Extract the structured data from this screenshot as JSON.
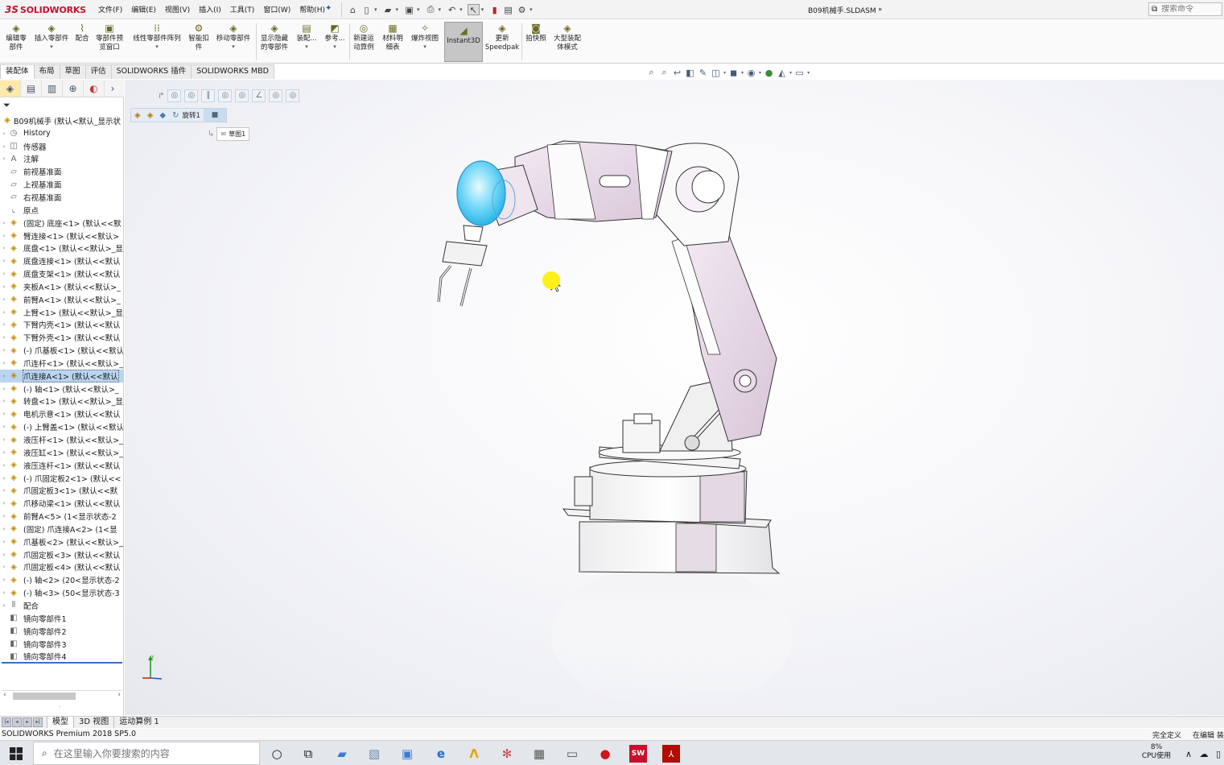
{
  "app": {
    "logo_ds": "3S",
    "logo_text": "SOLIDWORKS",
    "document_title": "B09机械手.SLDASM *"
  },
  "menu": [
    "文件(F)",
    "编辑(E)",
    "视图(V)",
    "插入(I)",
    "工具(T)",
    "窗口(W)",
    "帮助(H)"
  ],
  "search": {
    "placeholder": "搜索命令"
  },
  "commands": [
    {
      "label": "编辑零\n部件"
    },
    {
      "label": "插入零部件"
    },
    {
      "label": "配合"
    },
    {
      "label": "零部件预\n览窗口"
    },
    {
      "label": "线性零部件阵列"
    },
    {
      "label": "智能扣\n件"
    },
    {
      "label": "移动零部件"
    },
    {
      "label": "显示隐藏\n的零部件"
    },
    {
      "label": "装配..."
    },
    {
      "label": "参考..."
    },
    {
      "label": "新建运\n动算例"
    },
    {
      "label": "材料明\n细表"
    },
    {
      "label": "爆炸视图"
    },
    {
      "label": "Instant3D"
    },
    {
      "label": "更新\nSpeedpak"
    },
    {
      "label": "拍快照"
    },
    {
      "label": "大型装配\n体模式"
    }
  ],
  "tabs": [
    "装配体",
    "布局",
    "草图",
    "评估",
    "SOLIDWORKS 插件",
    "SOLIDWORKS MBD"
  ],
  "tree": {
    "root": "B09机械手 (默认<默认_显示状",
    "items": [
      {
        "label": "History",
        "icon": "history-icon"
      },
      {
        "label": "传感器",
        "icon": "sensor-icon"
      },
      {
        "label": "注解",
        "icon": "annotation-icon"
      },
      {
        "label": "前视基准面",
        "icon": "plane-icon"
      },
      {
        "label": "上视基准面",
        "icon": "plane-icon"
      },
      {
        "label": "右视基准面",
        "icon": "plane-icon"
      },
      {
        "label": "原点",
        "icon": "origin-icon"
      },
      {
        "label": "(固定) 底座<1> (默认<<默",
        "icon": "part-icon"
      },
      {
        "label": "臂连接<1> (默认<<默认>",
        "icon": "part-icon"
      },
      {
        "label": "底盘<1> (默认<<默认>_显",
        "icon": "part-icon"
      },
      {
        "label": "底盘连接<1> (默认<<默认",
        "icon": "part-icon"
      },
      {
        "label": "底盘支架<1> (默认<<默认",
        "icon": "part-icon"
      },
      {
        "label": "夹板A<1> (默认<<默认>_",
        "icon": "part-icon"
      },
      {
        "label": "前臂A<1> (默认<<默认>_",
        "icon": "part-icon"
      },
      {
        "label": "上臂<1> (默认<<默认>_显",
        "icon": "part-icon"
      },
      {
        "label": "下臂内壳<1> (默认<<默认",
        "icon": "part-icon"
      },
      {
        "label": "下臂外壳<1> (默认<<默认",
        "icon": "part-icon"
      },
      {
        "label": "(-) 爪基板<1> (默认<<默认",
        "icon": "part-icon"
      },
      {
        "label": "爪连杆<1> (默认<<默认>_",
        "icon": "part-icon"
      },
      {
        "label": "爪连接A<1> (默认<<默认",
        "icon": "part-icon",
        "selected": true
      },
      {
        "label": "(-) 轴<1> (默认<<默认>_",
        "icon": "part-icon"
      },
      {
        "label": "转盘<1> (默认<<默认>_显",
        "icon": "part-icon"
      },
      {
        "label": "电机示意<1> (默认<<默认",
        "icon": "part-icon"
      },
      {
        "label": "(-) 上臂盖<1> (默认<<默认",
        "icon": "part-icon"
      },
      {
        "label": "液压杆<1> (默认<<默认>_",
        "icon": "part-icon"
      },
      {
        "label": "液压缸<1> (默认<<默认>_",
        "icon": "part-icon"
      },
      {
        "label": "液压连杆<1> (默认<<默认",
        "icon": "part-icon"
      },
      {
        "label": "(-) 爪固定板2<1> (默认<<",
        "icon": "part-icon"
      },
      {
        "label": "爪固定板3<1> (默认<<默",
        "icon": "part-icon"
      },
      {
        "label": "爪移动梁<1> (默认<<默认",
        "icon": "part-icon"
      },
      {
        "label": "前臂A<5> (1<显示状态-2",
        "icon": "part-icon"
      },
      {
        "label": "(固定) 爪连接A<2> (1<显",
        "icon": "part-icon"
      },
      {
        "label": "爪基板<2> (默认<<默认>_",
        "icon": "part-icon"
      },
      {
        "label": "爪固定板<3> (默认<<默认",
        "icon": "part-icon"
      },
      {
        "label": "爪固定板<4> (默认<<默认",
        "icon": "part-icon"
      },
      {
        "label": "(-) 轴<2> (20<显示状态-2",
        "icon": "part-icon"
      },
      {
        "label": "(-) 轴<3> (50<显示状态-3",
        "icon": "part-icon"
      },
      {
        "label": "配合",
        "icon": "mates-icon"
      },
      {
        "label": "镜向零部件1",
        "icon": "mirror-icon"
      },
      {
        "label": "镜向零部件2",
        "icon": "mirror-icon"
      },
      {
        "label": "镜向零部件3",
        "icon": "mirror-icon"
      },
      {
        "label": "镜向零部件4",
        "icon": "mirror-icon"
      }
    ]
  },
  "viewport": {
    "breadcrumb_feature": "旋转1",
    "sketch_node": "草图1"
  },
  "bottom_tabs": [
    "模型",
    "3D 视图",
    "运动算例 1"
  ],
  "status": {
    "product": "SOLIDWORKS Premium 2018 SP5.0",
    "state": "完全定义",
    "mode": "在编辑 装"
  },
  "taskbar": {
    "search_placeholder": "在这里输入你要搜索的内容",
    "cpu_value": "8%",
    "cpu_label": "CPU使用"
  }
}
